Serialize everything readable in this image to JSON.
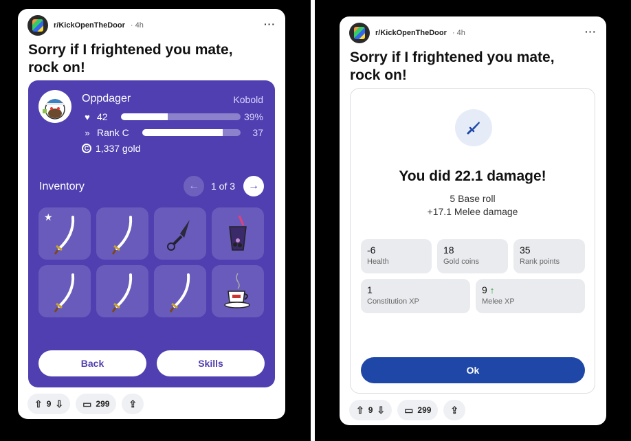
{
  "left": {
    "subreddit": "r/KickOpenTheDoor",
    "time": "4h",
    "more": "···",
    "title": "Sorry if I frightened you mate, rock on!",
    "player": {
      "name": "Oppdager",
      "class": "Kobold",
      "health": "42",
      "health_pct_label": "39%",
      "health_fraction": 0.39,
      "rank": "Rank C",
      "rank_value": "37",
      "rank_fraction": 0.82,
      "gold": "1,337 gold"
    },
    "inventory": {
      "title": "Inventory",
      "page": "1 of 3",
      "items": [
        "sword",
        "sword",
        "kunai",
        "bubble-tea",
        "sword",
        "sword",
        "sword",
        "coffee-cup"
      ]
    },
    "back_label": "Back",
    "skills_label": "Skills",
    "votes": "9",
    "comments": "299"
  },
  "right": {
    "subreddit": "r/KickOpenTheDoor",
    "time": "4h",
    "more": "···",
    "title": "Sorry if I frightened you mate, rock on!",
    "damage_title": "You did 22.1 damage!",
    "base_roll": "5 Base roll",
    "melee_bonus": "+17.1 Melee damage",
    "stats": [
      {
        "value": "-6",
        "label": "Health"
      },
      {
        "value": "18",
        "label": "Gold coins"
      },
      {
        "value": "35",
        "label": "Rank points"
      },
      {
        "value": "1",
        "label": "Constitution XP"
      },
      {
        "value": "9",
        "label": "Melee XP",
        "up": true
      }
    ],
    "ok_label": "Ok",
    "votes": "9",
    "comments": "299"
  },
  "colors": {
    "panel": "#4f3fb0",
    "ok_button": "#1e47a8",
    "up_arrow": "#2a9a3a"
  }
}
